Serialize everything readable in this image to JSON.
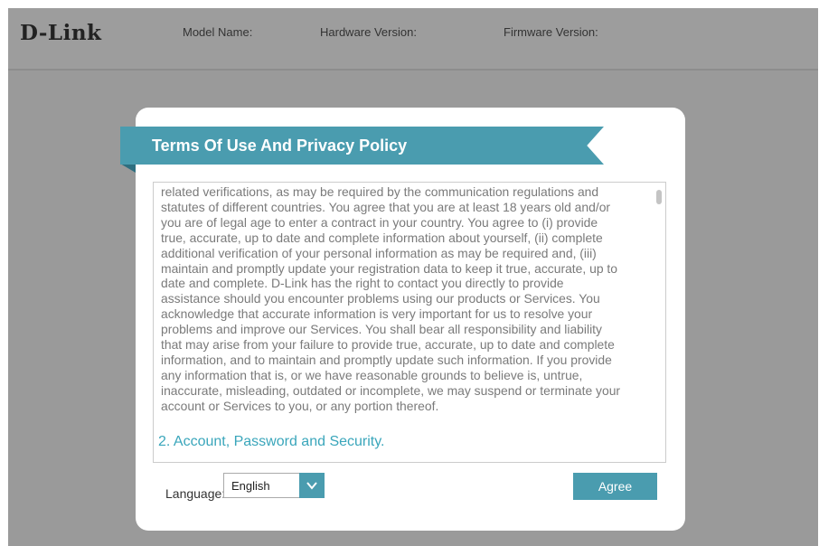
{
  "header": {
    "logo": "D-Link",
    "model_label": "Model Name:",
    "hardware_label": "Hardware Version:",
    "firmware_label": "Firmware Version:"
  },
  "modal": {
    "title": "Terms Of Use And Privacy Policy",
    "body_lines": [
      "related verifications, as may be required by the communication regulations and",
      "statutes of different countries. You agree that you are at least 18 years old and/or",
      "you are of legal age to enter a contract in your country. You agree to (i) provide",
      "true, accurate, up to date and complete information about yourself, (ii) complete",
      "additional verification of your personal information as may be required and, (iii)",
      "maintain and promptly update your registration data to keep it true, accurate, up to",
      "date and complete. D-Link has the right to contact you directly to provide",
      "assistance should you encounter problems using our products or Services. You",
      "acknowledge that accurate information is very important for us to resolve your",
      "problems and improve our Services. You shall bear all responsibility and liability",
      "that may arise from your failure to provide true, accurate, up to date and complete",
      "information, and to maintain and promptly update such information. If you provide",
      "any information that is, or we have reasonable grounds to believe is, untrue,",
      "inaccurate, misleading, outdated or incomplete, we may suspend or terminate your",
      "account or Services to you, or any portion thereof."
    ],
    "section_heading": "2. Account, Password and Security.",
    "language_label": "Language:",
    "language_value": "English",
    "agree_label": "Agree"
  },
  "colors": {
    "accent": "#4a9caf",
    "overlay": "#9a9a9a",
    "heading_text": "#3aa6bb"
  },
  "icons": {
    "dropdown": "chevron-down-icon"
  }
}
